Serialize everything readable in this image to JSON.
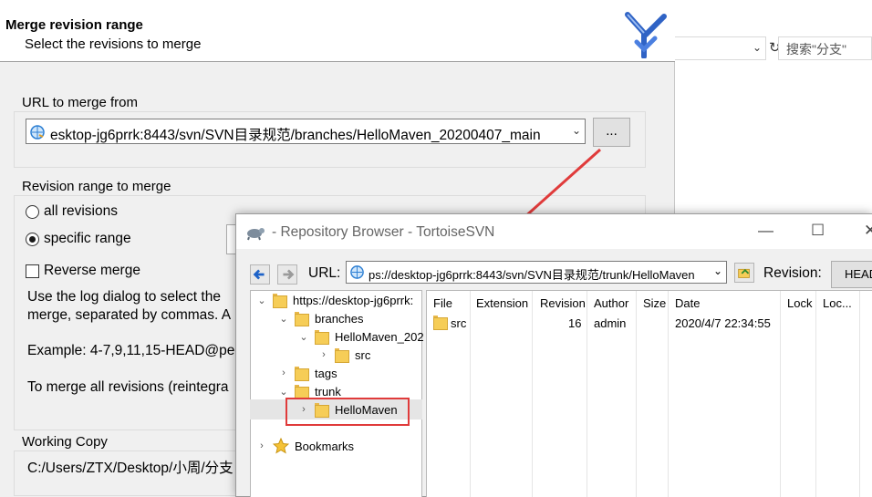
{
  "explorer": {
    "search_placeholder": "搜索\"分支\""
  },
  "merge": {
    "title": "Merge revision range",
    "subtitle": "Select the revisions to merge",
    "url_group_label": "URL to merge from",
    "url_value": "esktop-jg6prrk:8443/svn/SVN目录规范/branches/HelloMaven_20200407_main",
    "browse_label": "...",
    "range_group_label": "Revision range to merge",
    "all_revisions_label": "all revisions",
    "specific_range_label": "specific range",
    "selected_option": "specific range",
    "reverse_merge_label": "Reverse merge",
    "help_line1": "Use the log dialog to select the",
    "help_line2": "merge, separated by commas. A",
    "example_text": "Example: 4-7,9,11,15-HEAD@pe",
    "reintegrate_text": "To merge all revisions (reintegra",
    "working_copy_label": "Working Copy",
    "working_copy_path": "C:/Users/ZTX/Desktop/小周/分支"
  },
  "repo": {
    "title": "- Repository Browser - TortoiseSVN",
    "url_label": "URL:",
    "url_value": "ps://desktop-jg6prrk:8443/svn/SVN目录规范/trunk/HelloMaven",
    "revision_label": "Revision:",
    "head_label": "HEAD",
    "tree": {
      "root": "https://desktop-jg6prrk:",
      "branches": "branches",
      "branch_folder": "HelloMaven_202",
      "src": "src",
      "tags": "tags",
      "trunk": "trunk",
      "trunk_folder": "HelloMaven",
      "bookmarks": "Bookmarks"
    },
    "columns": [
      "File",
      "Extension",
      "Revision",
      "Author",
      "Size",
      "Date",
      "Lock",
      "Loc..."
    ],
    "rows": [
      {
        "file": "src",
        "extension": "",
        "revision": "16",
        "author": "admin",
        "size": "",
        "date": "2020/4/7 22:34:55",
        "lock": "",
        "loc": ""
      }
    ]
  }
}
